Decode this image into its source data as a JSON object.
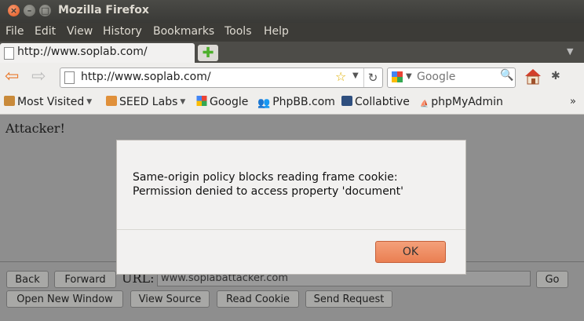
{
  "window": {
    "title": "Mozilla Firefox"
  },
  "menu": [
    "File",
    "Edit",
    "View",
    "History",
    "Bookmarks",
    "Tools",
    "Help"
  ],
  "tab": {
    "label": "http://www.soplab.com/"
  },
  "navbar": {
    "url": "http://www.soplab.com/",
    "search_placeholder": "Google"
  },
  "bookmarks": [
    "Most Visited",
    "SEED Labs",
    "Google",
    "PhpBB.com",
    "Collabtive",
    "phpMyAdmin"
  ],
  "page": {
    "heading": "Attacker!",
    "buttons": {
      "back": "Back",
      "forward": "Forward",
      "go": "Go",
      "open_new_window": "Open New Window",
      "view_source": "View Source",
      "read_cookie": "Read Cookie",
      "send_request": "Send Request"
    },
    "url_label": "URL:",
    "url_value": "www.soplabattacker.com"
  },
  "dialog": {
    "message_line1": "Same-origin policy blocks reading frame cookie:",
    "message_line2": "Permission denied to access property 'document'",
    "ok_label": "OK"
  },
  "colors": {
    "titlebar": "#3c3b37",
    "accent": "#e3561f",
    "ok_button": "#ee8a5f"
  }
}
